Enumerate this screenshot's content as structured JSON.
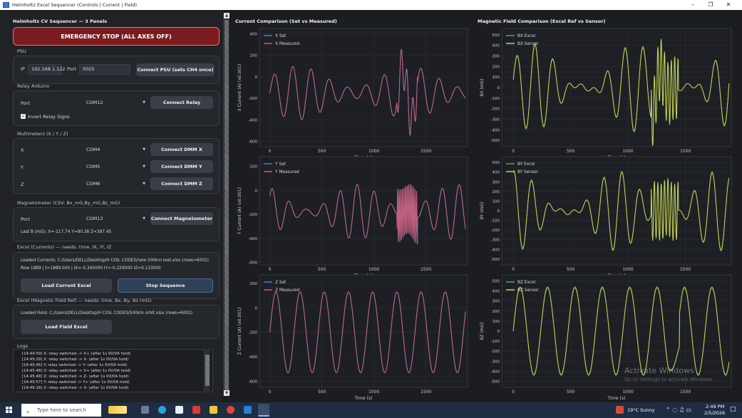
{
  "window": {
    "title": "Helmholtz Excel Sequencer (Controls | Current | Field)",
    "minimize": "–",
    "maximize": "❐",
    "close": "✕"
  },
  "left": {
    "title": "Helmholtz CV Sequencer — 3 Panels",
    "estop_label": "EMERGENCY STOP (ALL AXES OFF)",
    "psu": {
      "section": "PSU",
      "ip_label": "IP",
      "ip_value": "192.168.1.122",
      "port_label": "Port",
      "port_value": "5025",
      "connect_label": "Connect PSU (sets CH4 once)"
    },
    "relay": {
      "section": "Relay Arduino",
      "port_label": "Port",
      "port_value": "COM12",
      "connect_label": "Connect Relay",
      "invert_label": "Invert Relay Signs",
      "invert_checked": true
    },
    "dmm": {
      "section": "Multimeters (X / Y / Z)",
      "rows": [
        {
          "axis": "X",
          "port": "COM4",
          "button": "Connect DMM X"
        },
        {
          "axis": "Y",
          "port": "COM5",
          "button": "Connect DMM Y"
        },
        {
          "axis": "Z",
          "port": "COM6",
          "button": "Connect DMM Z"
        }
      ]
    },
    "mag": {
      "section": "Magnetometer (CSV: Bx_mG,By_mG,Bz_mG)",
      "port_label": "Port",
      "port_value": "COM13",
      "connect_label": "Connect Magnetometer",
      "last_b": "Last B (mG): X=-117.74  Y=80.38  Z=387.45"
    },
    "currents": {
      "section": "Excel (Currents) — needs: time, IX, IY, IZ",
      "loaded": "Loaded Currents: C:/Users/DELL/Desktop/H COIL CODES/new 500km test.xlsx  (rows=6002)",
      "row_status": "Row 1889 | t=1889.000 | IX=-0.345000 IY=-0.229000 IZ=0.133000",
      "load_label": "Load Current Excel",
      "stop_label": "Stop Sequence"
    },
    "field": {
      "section": "Excel (Magnetic Field Ref) — needs: time, Bx, By, Bz (mG)",
      "loaded": "Loaded Field: C:/Users/DELL/Desktop/H COIL CODES/500km orbit.xlsx  (rows=6002)",
      "load_label": "Load Field Excel"
    },
    "logs": {
      "section": "Logs",
      "lines": [
        "[14:44:59] X: relay switched -> X+ (after 1s 0V/0A hold)",
        "[14:45:29] X: relay switched -> X- (after 1s 0V/0A hold)",
        "[14:45:46] Y: relay switched -> Y- (after 1s 0V/0A hold)",
        "[14:45:48] X: relay switched -> X+ (after 1s 0V/0A hold)",
        "[14:45:48] Z: relay switched -> Z- (after 1s 0V/0A hold)",
        "[14:45:57] Y: relay switched -> Y+ (after 1s 0V/0A hold)",
        "[14:46:18] X: relay switched -> X- (after 1s 0V/0A hold)"
      ]
    }
  },
  "plots": {
    "current_title": "Current Comparison (Set vs Measured)",
    "field_title": "Magnetic Field Comparison (Excel Ref vs Sensor)",
    "colors": {
      "set": "#2f8cf0",
      "measured": "#ee5560",
      "excel": "#3dbb5f",
      "sensor": "#f0cf4a"
    }
  },
  "chart_data": [
    {
      "type": "line",
      "title": "",
      "xlabel": "Time (s)",
      "ylabel": "X Current (A) (x0.001)",
      "xlim": [
        -100,
        1900
      ],
      "ylim": [
        -650,
        450
      ],
      "x_ticks": [
        0,
        500,
        1000,
        1500
      ],
      "y_ticks": [
        -600,
        -400,
        -200,
        0,
        200,
        400
      ],
      "series": [
        {
          "name": "X Set"
        },
        {
          "name": "X Measured"
        }
      ],
      "legend": "top-left",
      "grid": true
    },
    {
      "type": "line",
      "title": "",
      "xlabel": "Time (s)",
      "ylabel": "Y Current (A) (x0.001)",
      "xlim": [
        -100,
        1900
      ],
      "ylim": [
        -620,
        280
      ],
      "x_ticks": [
        0,
        500,
        1000,
        1500
      ],
      "y_ticks": [
        -600,
        -400,
        -200,
        0,
        200
      ],
      "series": [
        {
          "name": "Y Set"
        },
        {
          "name": "Y Measured"
        }
      ],
      "legend": "top-left",
      "grid": true
    },
    {
      "type": "line",
      "title": "",
      "xlabel": "Time (s)",
      "ylabel": "Z Current (A) (x0.001)",
      "xlim": [
        -100,
        1900
      ],
      "ylim": [
        -650,
        270
      ],
      "x_ticks": [
        0,
        500,
        1000,
        1500
      ],
      "y_ticks": [
        -600,
        -400,
        -200,
        0,
        200
      ],
      "series": [
        {
          "name": "Z Set"
        },
        {
          "name": "Z Measured"
        }
      ],
      "legend": "top-left",
      "grid": true
    },
    {
      "type": "line",
      "title": "",
      "xlabel": "Time (s)",
      "ylabel": "BX (mG)",
      "xlim": [
        -100,
        1900
      ],
      "ylim": [
        -560,
        560
      ],
      "x_ticks": [
        0,
        500,
        1000,
        1500
      ],
      "y_ticks": [
        -500,
        -400,
        -300,
        -200,
        -100,
        0,
        100,
        200,
        300,
        400,
        500
      ],
      "series": [
        {
          "name": "BX Excel"
        },
        {
          "name": "BX Sensor"
        }
      ],
      "legend": "top-left",
      "grid": true
    },
    {
      "type": "line",
      "title": "",
      "xlabel": "Time (s)",
      "ylabel": "BY (mG)",
      "xlim": [
        -100,
        1900
      ],
      "ylim": [
        -560,
        560
      ],
      "x_ticks": [
        0,
        500,
        1000,
        1500
      ],
      "y_ticks": [
        -500,
        -400,
        -300,
        -200,
        -100,
        0,
        100,
        200,
        300,
        400,
        500
      ],
      "series": [
        {
          "name": "BY Excel"
        },
        {
          "name": "BY Sensor"
        }
      ],
      "legend": "top-left",
      "grid": true
    },
    {
      "type": "line",
      "title": "",
      "xlabel": "Time (s)",
      "ylabel": "BZ (mG)",
      "xlim": [
        -100,
        1900
      ],
      "ylim": [
        -560,
        560
      ],
      "x_ticks": [
        0,
        500,
        1000,
        1500
      ],
      "y_ticks": [
        -500,
        -400,
        -300,
        -200,
        -100,
        0,
        100,
        200,
        300,
        400,
        500
      ],
      "series": [
        {
          "name": "BZ Excel"
        },
        {
          "name": "BZ Sensor"
        }
      ],
      "legend": "top-left",
      "grid": true
    }
  ],
  "watermark": {
    "line1": "Activate Windows",
    "line2": "Go to Settings to activate Windows."
  },
  "taskbar": {
    "search_placeholder": "Type here to search",
    "weather": "19°C  Sunny",
    "time": "2:49 PM",
    "date": "2/5/2026"
  }
}
